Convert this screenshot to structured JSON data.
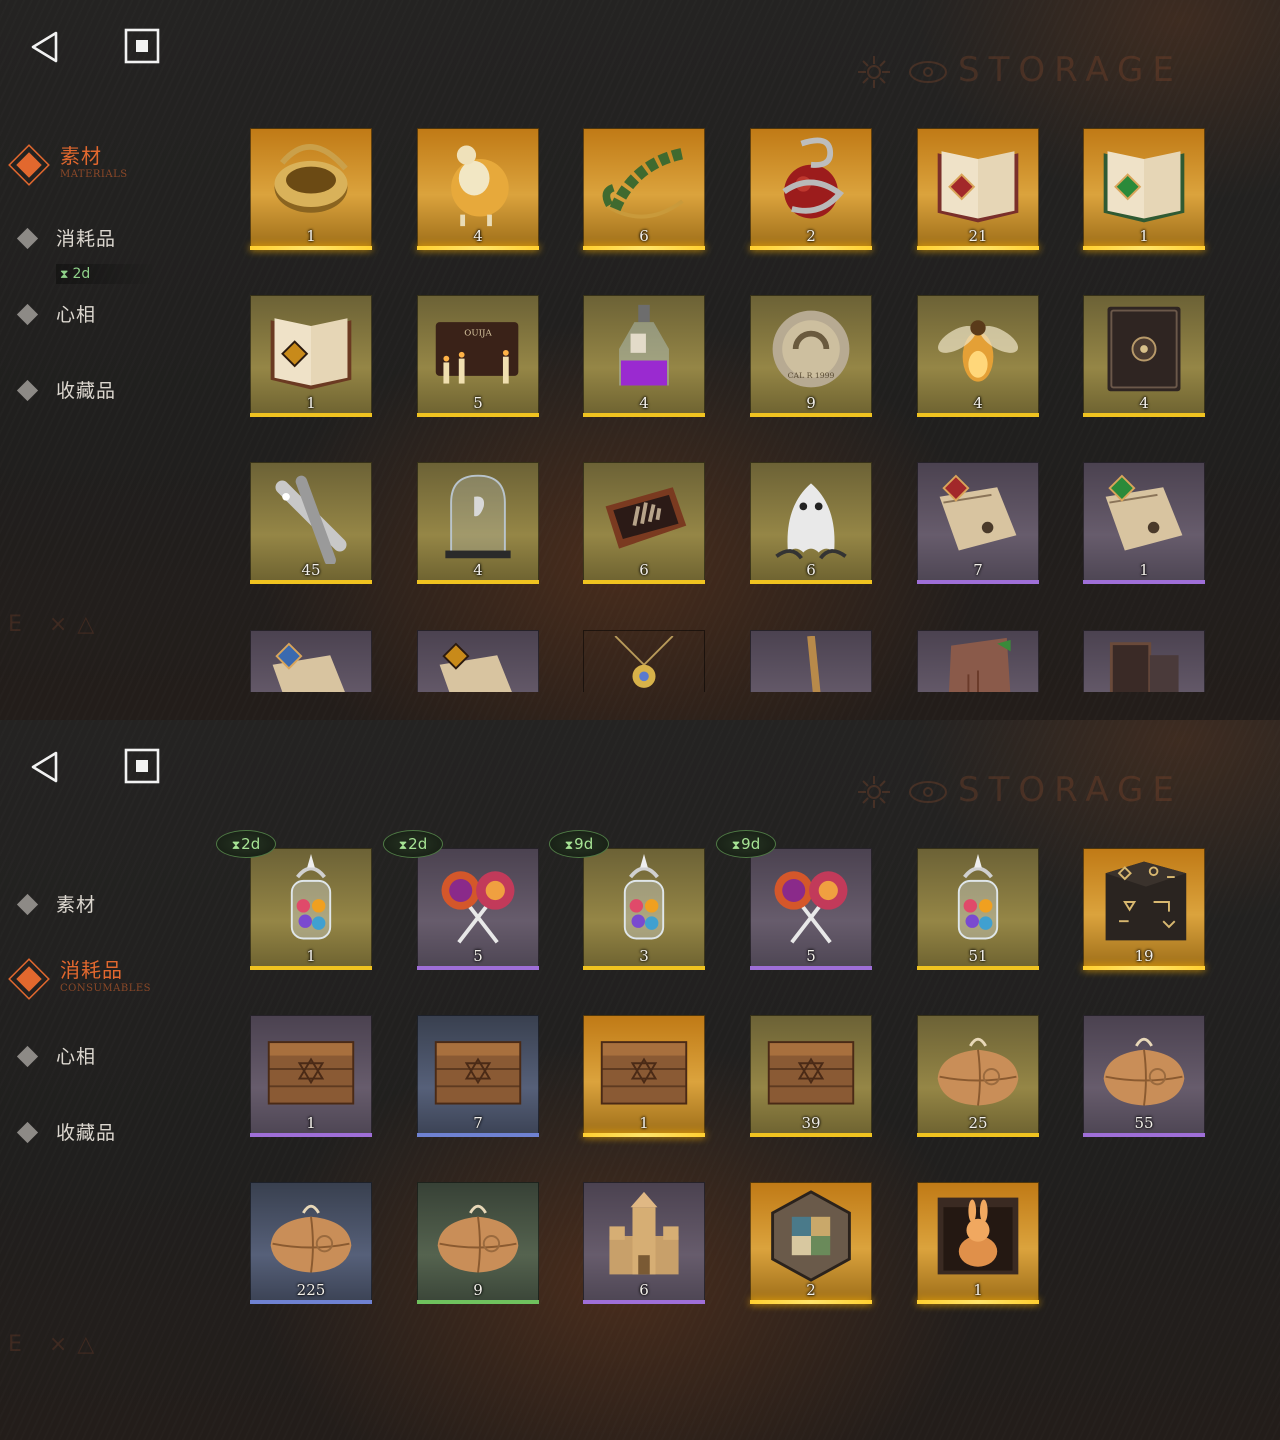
{
  "watermark": {
    "text": "STORAGE",
    "corner": "E ×△"
  },
  "panel_a": {
    "sidebar": [
      {
        "label": "素材",
        "sub": "MATERIALS",
        "active": true
      },
      {
        "label": "消耗品",
        "timer": "2d"
      },
      {
        "label": "心相"
      },
      {
        "label": "收藏品"
      }
    ],
    "items": [
      {
        "count": "1",
        "rarity": "gold",
        "icon": "golden-ring-icon"
      },
      {
        "count": "4",
        "rarity": "gold",
        "icon": "golden-sheep-icon"
      },
      {
        "count": "6",
        "rarity": "gold",
        "icon": "laurel-wreath-icon"
      },
      {
        "count": "2",
        "rarity": "gold",
        "icon": "snake-apple-icon"
      },
      {
        "count": "21",
        "rarity": "gold",
        "icon": "red-rune-book-icon"
      },
      {
        "count": "1",
        "rarity": "gold",
        "icon": "green-rune-book-icon"
      },
      {
        "count": "1",
        "rarity": "yellow",
        "icon": "gold-rune-book-icon"
      },
      {
        "count": "5",
        "rarity": "yellow",
        "icon": "ouija-board-icon"
      },
      {
        "count": "4",
        "rarity": "yellow",
        "icon": "purple-potion-bottle-icon"
      },
      {
        "count": "9",
        "rarity": "yellow",
        "icon": "brass-disc-icon"
      },
      {
        "count": "4",
        "rarity": "yellow",
        "icon": "firefly-icon"
      },
      {
        "count": "4",
        "rarity": "yellow",
        "icon": "dark-tome-icon"
      },
      {
        "count": "45",
        "rarity": "yellow",
        "icon": "bullets-icon"
      },
      {
        "count": "4",
        "rarity": "yellow",
        "icon": "glass-dome-icon"
      },
      {
        "count": "6",
        "rarity": "yellow",
        "icon": "hand-box-icon"
      },
      {
        "count": "6",
        "rarity": "yellow",
        "icon": "ghost-icon"
      },
      {
        "count": "7",
        "rarity": "purple",
        "icon": "red-rune-scroll-icon"
      },
      {
        "count": "1",
        "rarity": "purple",
        "icon": "green-rune-scroll-icon"
      }
    ],
    "partial_items": [
      {
        "rarity": "purple",
        "icon": "blue-rune-scroll-icon"
      },
      {
        "rarity": "purple",
        "icon": "gold-rune-scroll-icon"
      },
      {
        "rarity": "none",
        "icon": "amulet-pendant-icon"
      },
      {
        "rarity": "purple",
        "icon": "brass-tool-icon"
      },
      {
        "rarity": "purple",
        "icon": "stone-tablet-icon"
      },
      {
        "rarity": "purple",
        "icon": "dark-frame-icon"
      }
    ]
  },
  "panel_b": {
    "sidebar": [
      {
        "label": "素材"
      },
      {
        "label": "消耗品",
        "sub": "CONSUMABLES",
        "active": true
      },
      {
        "label": "心相"
      },
      {
        "label": "收藏品"
      }
    ],
    "items": [
      {
        "count": "1",
        "rarity": "yellow",
        "icon": "candy-jar-icon",
        "timer": "2d"
      },
      {
        "count": "5",
        "rarity": "purple",
        "icon": "lollipops-icon",
        "timer": "2d"
      },
      {
        "count": "3",
        "rarity": "yellow",
        "icon": "candy-jar-icon",
        "timer": "9d"
      },
      {
        "count": "5",
        "rarity": "purple",
        "icon": "lollipops-icon",
        "timer": "9d"
      },
      {
        "count": "51",
        "rarity": "yellow",
        "icon": "candy-jar-icon"
      },
      {
        "count": "19",
        "rarity": "gold",
        "icon": "rune-chest-icon"
      },
      {
        "count": "1",
        "rarity": "purple",
        "icon": "wooden-crate-icon"
      },
      {
        "count": "7",
        "rarity": "blue",
        "icon": "wooden-crate-icon"
      },
      {
        "count": "1",
        "rarity": "gold",
        "icon": "wooden-crate-icon"
      },
      {
        "count": "39",
        "rarity": "yellow",
        "icon": "wooden-crate-icon"
      },
      {
        "count": "25",
        "rarity": "yellow",
        "icon": "paper-parcel-icon"
      },
      {
        "count": "55",
        "rarity": "purple",
        "icon": "paper-parcel-icon"
      },
      {
        "count": "225",
        "rarity": "blue",
        "icon": "paper-parcel-icon"
      },
      {
        "count": "9",
        "rarity": "green",
        "icon": "paper-parcel-icon"
      },
      {
        "count": "6",
        "rarity": "purple",
        "icon": "sand-castle-icon"
      },
      {
        "count": "2",
        "rarity": "gold",
        "icon": "hexagon-puzzle-icon"
      },
      {
        "count": "1",
        "rarity": "gold",
        "icon": "rabbit-box-icon"
      }
    ]
  },
  "colors": {
    "accent": "#e2682e",
    "timer": "#8fd28a",
    "gold": "#ffd23a",
    "yellow": "#f0c320",
    "purple": "#9f6fd8",
    "blue": "#6f82d2",
    "green": "#6fc25e"
  }
}
